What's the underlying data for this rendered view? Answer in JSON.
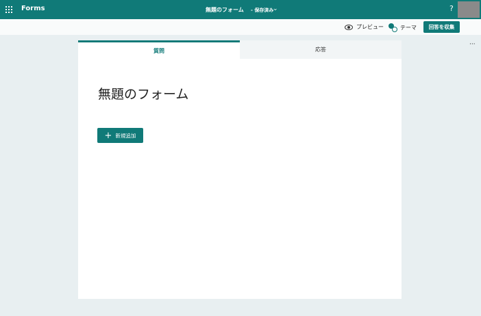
{
  "topbar": {
    "app_name": "Forms",
    "doc_title": "無題のフォーム",
    "doc_status": "- 保存済み",
    "help_label": "?",
    "icons": {
      "waffle": "waffle-icon",
      "chevron": "chevron-down-icon"
    }
  },
  "commandbar": {
    "preview_label": "プレビュー",
    "theme_label": "テーマ",
    "collect_label": "回答を収集",
    "more_label": "···",
    "icons": {
      "preview": "eye-icon",
      "theme": "palette-icon"
    }
  },
  "tabs": [
    {
      "label": "質問",
      "active": true
    },
    {
      "label": "応答",
      "active": false
    }
  ],
  "form": {
    "title": "無題のフォーム",
    "add_new_label": "新規追加"
  },
  "colors": {
    "accent": "#107a78",
    "background": "#e8eff1"
  }
}
